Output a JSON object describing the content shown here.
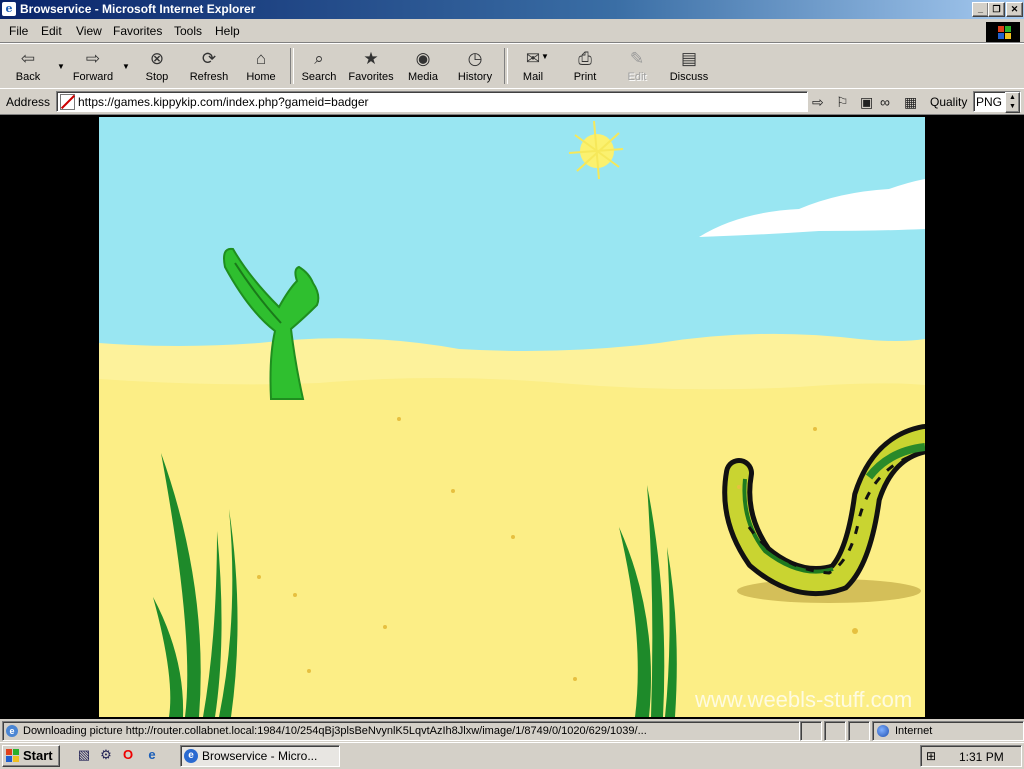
{
  "window": {
    "title": "Browservice - Microsoft Internet Explorer"
  },
  "menu": [
    "File",
    "Edit",
    "View",
    "Favorites",
    "Tools",
    "Help"
  ],
  "toolbar": {
    "back": "Back",
    "forward": "Forward",
    "stop": "Stop",
    "refresh": "Refresh",
    "home": "Home",
    "search": "Search",
    "favorites": "Favorites",
    "media": "Media",
    "history": "History",
    "mail": "Mail",
    "print": "Print",
    "edit": "Edit",
    "discuss": "Discuss"
  },
  "address": {
    "label": "Address",
    "url": "https://games.kippykip.com/index.php?gameid=badger",
    "quality_label": "Quality",
    "quality_value": "PNG"
  },
  "game": {
    "watermark": "www.weebls-stuff.com"
  },
  "status": {
    "text": "Downloading picture http://router.collabnet.local:1984/10/254qBj3plsBeNvynlK5LqvtAzIh8Jlxw/image/1/8749/0/1020/629/1039/...",
    "zone": "Internet"
  },
  "taskbar": {
    "start": "Start",
    "task": "Browservice - Micro...",
    "clock": "1:31 PM"
  },
  "colors": {
    "sky": "#99e6f2",
    "sand": "#fcf187",
    "cactus": "#2fbf2f",
    "titlebar": "#0a246a"
  }
}
